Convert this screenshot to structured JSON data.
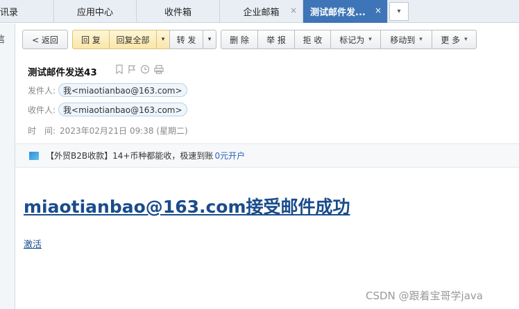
{
  "tabs": [
    {
      "label": "通讯录"
    },
    {
      "label": "应用中心"
    },
    {
      "label": "收件箱"
    },
    {
      "label": "企业邮箱"
    },
    {
      "label": "测试邮件发..."
    }
  ],
  "tab_close_glyph": "×",
  "tab_more_glyph": "▾",
  "sidebar": {
    "partial_label": "信"
  },
  "toolbar": {
    "back": "< 返回",
    "reply": "回 复",
    "reply_all": "回复全部",
    "forward": "转 发",
    "delete": "删 除",
    "report": "举 报",
    "reject": "拒 收",
    "mark_as": "标记为",
    "move_to": "移动到",
    "more": "更 多",
    "caret": "▾"
  },
  "mail": {
    "subject": "测试邮件发送43",
    "sender_label": "发件人:",
    "sender": "我<miaotianbao@163.com>",
    "recipient_label": "收件人:",
    "recipient": "我<miaotianbao@163.com>",
    "time_label": "时　间:",
    "time": "2023年02月21日 09:38 (星期二)"
  },
  "ad": {
    "text": "【外贸B2B收款】14+币种都能收，极速到账",
    "link": "0元开户"
  },
  "content": {
    "title": "miaotianbao@163.com接受邮件成功",
    "link": "激活"
  },
  "watermark": "CSDN @跟着宝哥学java",
  "colors": {
    "active_tab": "#3e75b8",
    "link": "#1a4c8c",
    "reply_button": "#f9e6a8"
  }
}
